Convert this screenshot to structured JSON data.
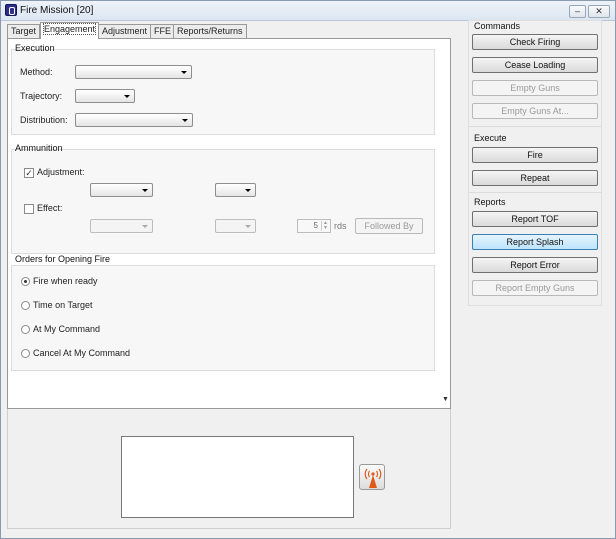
{
  "window": {
    "title": "Fire Mission [20]",
    "minimize_glyph": "–",
    "close_glyph": "✕"
  },
  "tabs": [
    {
      "label": "Target"
    },
    {
      "label": "Engagement",
      "active": true
    },
    {
      "label": "Adjustment"
    },
    {
      "label": "FFE"
    },
    {
      "label": "Reports/Returns"
    }
  ],
  "execution": {
    "title": "Execution",
    "method_label": "Method:",
    "trajectory_label": "Trajectory:",
    "distribution_label": "Distribution:"
  },
  "ammunition": {
    "title": "Ammunition",
    "adjustment_label": "Adjustment:",
    "adjustment_checked": true,
    "effect_label": "Effect:",
    "effect_checked": false,
    "rounds_value": "5",
    "rounds_unit": "rds",
    "followed_by_label": "Followed By"
  },
  "orders": {
    "title": "Orders for Opening Fire",
    "options": [
      {
        "label": "Fire when ready",
        "selected": true
      },
      {
        "label": "Time on Target",
        "selected": false
      },
      {
        "label": "At My Command",
        "selected": false
      },
      {
        "label": "Cancel At My Command",
        "selected": false
      }
    ]
  },
  "commands": {
    "title": "Commands",
    "check_firing": "Check Firing",
    "cease_loading": "Cease Loading",
    "empty_guns": "Empty Guns",
    "empty_guns_at": "Empty Guns At..."
  },
  "execute": {
    "title": "Execute",
    "fire": "Fire",
    "repeat": "Repeat"
  },
  "reports": {
    "title": "Reports",
    "report_tof": "Report TOF",
    "report_splash": "Report Splash",
    "report_error": "Report Error",
    "report_empty_guns": "Report Empty Guns"
  },
  "icons": {
    "app": "fire-mission-app-icon",
    "radio": "radio-transmitter-icon",
    "radio_color": "#e05a1a",
    "scroll": "scroll-down-arrow-icon"
  },
  "colors": {
    "highlight_button": "#bde4fb",
    "panel_bg": "#f0f0f0"
  }
}
